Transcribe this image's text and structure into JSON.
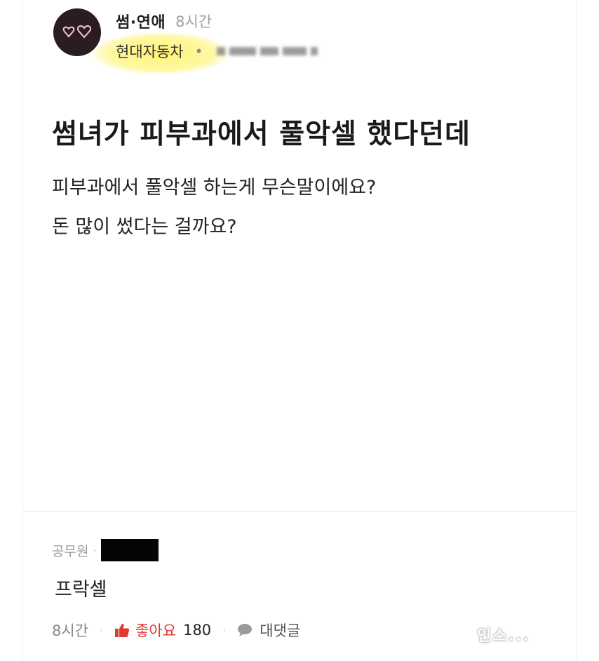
{
  "post": {
    "board": "썸·연애",
    "time": "8시간",
    "company": "현대자동차",
    "separator": "•",
    "title": "썸녀가 피부과에서 풀악셀 했다던데",
    "body": [
      "피부과에서 풀악셀 하는게 무슨말이에요?",
      "돈 많이 썼다는 걸까요?"
    ]
  },
  "comment": {
    "company": "공무원",
    "separator": "·",
    "text": "프락셀",
    "time": "8시간",
    "like_label": "좋아요",
    "like_count": "180",
    "reply_label": "대댓글",
    "action_separator": "·"
  },
  "watermark": "인스...",
  "colors": {
    "like": "#e03a2e",
    "highlight": "#fff36e",
    "avatar_bg": "#2b1d1f",
    "avatar_hearts": "#f4c6d6"
  },
  "icons": {
    "avatar": "hearts-icon",
    "like": "thumbs-up-icon",
    "reply": "speech-bubble-icon"
  }
}
